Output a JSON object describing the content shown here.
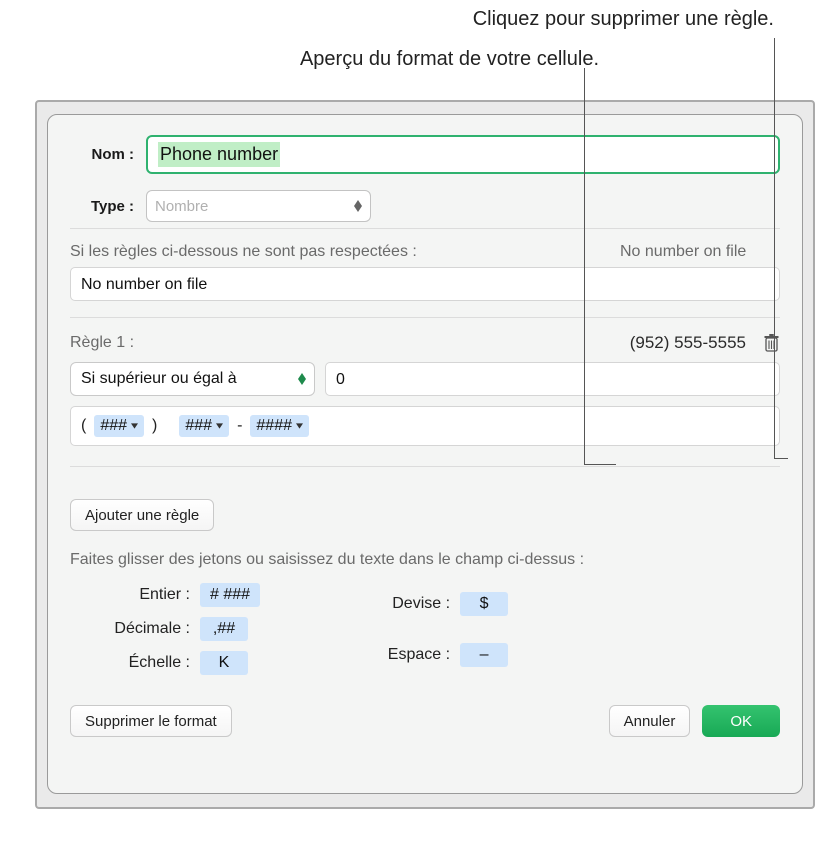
{
  "callouts": {
    "delete_rule": "Cliquez pour supprimer une règle.",
    "format_preview": "Aperçu du format de votre cellule."
  },
  "dialog": {
    "name_label": "Nom :",
    "name_value": "Phone number",
    "type_label": "Type :",
    "type_value": "Nombre",
    "unmatched": {
      "label": "Si les règles ci-dessous ne sont pas respectées :",
      "value": "No number on file",
      "preview": "No number on file"
    },
    "rule1": {
      "title": "Règle 1 :",
      "preview": "(952) 555-5555",
      "condition": "Si supérieur ou égal à",
      "threshold": "0",
      "format_tokens": {
        "open_paren": "(",
        "tok1": "###",
        "close_paren": ")",
        "tok2": "###",
        "dash": "-",
        "tok3": "####"
      }
    },
    "add_rule": "Ajouter une règle",
    "hint": "Faites glisser des jetons ou saisissez du texte dans le champ ci-dessus :",
    "tokens": {
      "integer_label": "Entier :",
      "integer_token": "# ###",
      "decimal_label": "Décimale :",
      "decimal_token": ",##",
      "scale_label": "Échelle :",
      "scale_token": "K",
      "currency_label": "Devise :",
      "currency_token": "$",
      "space_label": "Espace :",
      "space_token": "–"
    },
    "footer": {
      "delete_format": "Supprimer le format",
      "cancel": "Annuler",
      "ok": "OK"
    }
  }
}
